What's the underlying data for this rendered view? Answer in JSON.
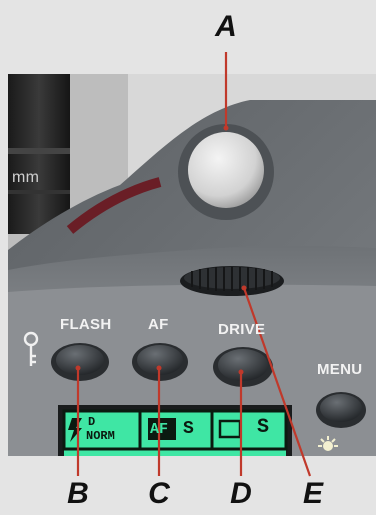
{
  "callouts": {
    "a": "A",
    "b": "B",
    "c": "C",
    "d": "D",
    "e": "E"
  },
  "camera": {
    "lens_marking": "mm",
    "buttons": {
      "flash": "FLASH",
      "af": "AF",
      "drive": "DRIVE",
      "menu": "MENU"
    },
    "lcd": {
      "flash_mode_top": "D",
      "flash_mode_bottom": "NORM",
      "af_badge": "AF",
      "af_mode": "S",
      "drive_mode": "S"
    },
    "key_icon": "key-icon",
    "backlight_icon": "sun-icon"
  },
  "colors": {
    "leader_line": "#c0392b",
    "lcd_background": "#3fe6a4",
    "body_gray": "#7d8084"
  }
}
